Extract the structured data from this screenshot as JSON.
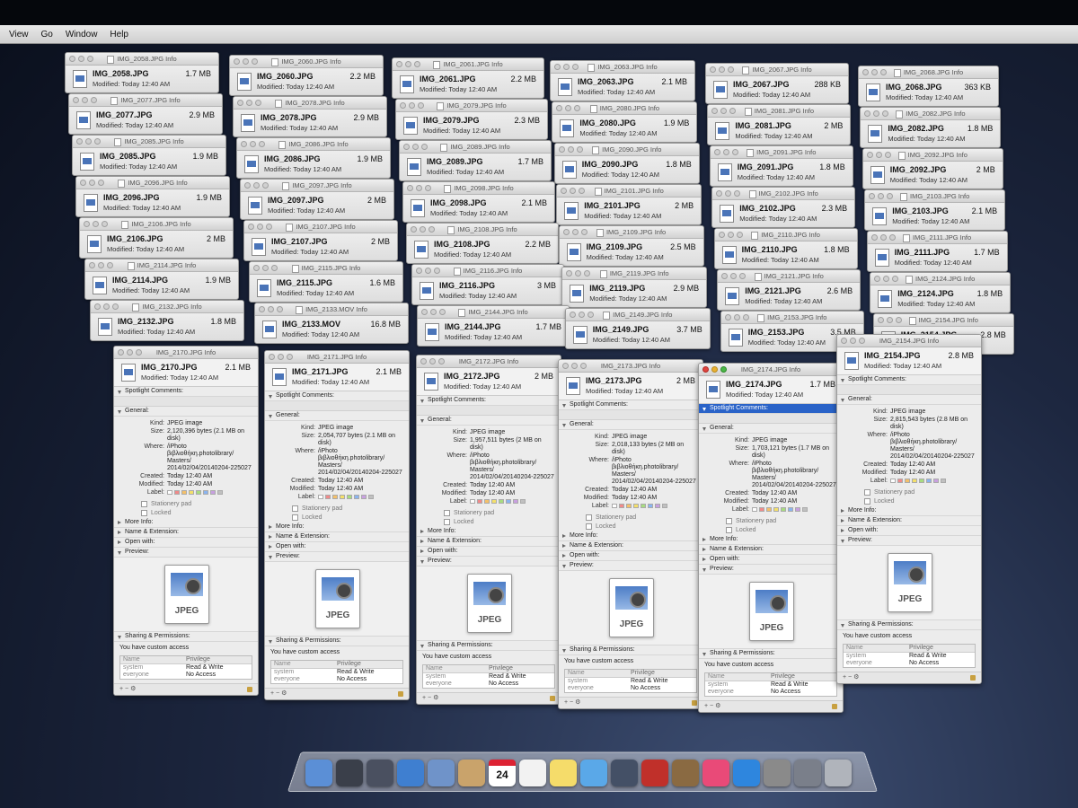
{
  "menubar": {
    "items": [
      "View",
      "Go",
      "Window",
      "Help"
    ]
  },
  "info_windows": [
    {
      "title": "IMG_2058.JPG Info",
      "name": "IMG_2058.JPG",
      "size": "1.7 MB",
      "modified": "Modified: Today 12:40 AM"
    },
    {
      "title": "IMG_2060.JPG Info",
      "name": "IMG_2060.JPG",
      "size": "2.2 MB",
      "modified": "Modified: Today 12:40 AM"
    },
    {
      "title": "IMG_2061.JPG Info",
      "name": "IMG_2061.JPG",
      "size": "2.2 MB",
      "modified": "Modified: Today 12:40 AM"
    },
    {
      "title": "IMG_2063.JPG Info",
      "name": "IMG_2063.JPG",
      "size": "2.1 MB",
      "modified": "Modified: Today 12:40 AM"
    },
    {
      "title": "IMG_2067.JPG Info",
      "name": "IMG_2067.JPG",
      "size": "288 KB",
      "modified": "Modified: Today 12:40 AM"
    },
    {
      "title": "IMG_2068.JPG Info",
      "name": "IMG_2068.JPG",
      "size": "363 KB",
      "modified": "Modified: Today 12:40 AM"
    },
    {
      "title": "IMG_2077.JPG Info",
      "name": "IMG_2077.JPG",
      "size": "2.9 MB",
      "modified": "Modified: Today 12:40 AM"
    },
    {
      "title": "IMG_2078.JPG Info",
      "name": "IMG_2078.JPG",
      "size": "2.9 MB",
      "modified": "Modified: Today 12:40 AM"
    },
    {
      "title": "IMG_2079.JPG Info",
      "name": "IMG_2079.JPG",
      "size": "2.3 MB",
      "modified": "Modified: Today 12:40 AM"
    },
    {
      "title": "IMG_2080.JPG Info",
      "name": "IMG_2080.JPG",
      "size": "1.9 MB",
      "modified": "Modified: Today 12:40 AM"
    },
    {
      "title": "IMG_2081.JPG Info",
      "name": "IMG_2081.JPG",
      "size": "2 MB",
      "modified": "Modified: Today 12:40 AM"
    },
    {
      "title": "IMG_2082.JPG Info",
      "name": "IMG_2082.JPG",
      "size": "1.8 MB",
      "modified": "Modified: Today 12:40 AM"
    },
    {
      "title": "IMG_2085.JPG Info",
      "name": "IMG_2085.JPG",
      "size": "1.9 MB",
      "modified": "Modified: Today 12:40 AM"
    },
    {
      "title": "IMG_2086.JPG Info",
      "name": "IMG_2086.JPG",
      "size": "1.9 MB",
      "modified": "Modified: Today 12:40 AM"
    },
    {
      "title": "IMG_2089.JPG Info",
      "name": "IMG_2089.JPG",
      "size": "1.7 MB",
      "modified": "Modified: Today 12:40 AM"
    },
    {
      "title": "IMG_2090.JPG Info",
      "name": "IMG_2090.JPG",
      "size": "1.8 MB",
      "modified": "Modified: Today 12:40 AM"
    },
    {
      "title": "IMG_2091.JPG Info",
      "name": "IMG_2091.JPG",
      "size": "1.8 MB",
      "modified": "Modified: Today 12:40 AM"
    },
    {
      "title": "IMG_2092.JPG Info",
      "name": "IMG_2092.JPG",
      "size": "2 MB",
      "modified": "Modified: Today 12:40 AM"
    },
    {
      "title": "IMG_2096.JPG Info",
      "name": "IMG_2096.JPG",
      "size": "1.9 MB",
      "modified": "Modified: Today 12:40 AM"
    },
    {
      "title": "IMG_2097.JPG Info",
      "name": "IMG_2097.JPG",
      "size": "2 MB",
      "modified": "Modified: Today 12:40 AM"
    },
    {
      "title": "IMG_2098.JPG Info",
      "name": "IMG_2098.JPG",
      "size": "2.1 MB",
      "modified": "Modified: Today 12:40 AM"
    },
    {
      "title": "IMG_2101.JPG Info",
      "name": "IMG_2101.JPG",
      "size": "2 MB",
      "modified": "Modified: Today 12:40 AM"
    },
    {
      "title": "IMG_2102.JPG Info",
      "name": "IMG_2102.JPG",
      "size": "2.3 MB",
      "modified": "Modified: Today 12:40 AM"
    },
    {
      "title": "IMG_2103.JPG Info",
      "name": "IMG_2103.JPG",
      "size": "2.1 MB",
      "modified": "Modified: Today 12:40 AM"
    },
    {
      "title": "IMG_2106.JPG Info",
      "name": "IMG_2106.JPG",
      "size": "2 MB",
      "modified": "Modified: Today 12:40 AM"
    },
    {
      "title": "IMG_2107.JPG Info",
      "name": "IMG_2107.JPG",
      "size": "2 MB",
      "modified": "Modified: Today 12:40 AM"
    },
    {
      "title": "IMG_2108.JPG Info",
      "name": "IMG_2108.JPG",
      "size": "2.2 MB",
      "modified": "Modified: Today 12:40 AM"
    },
    {
      "title": "IMG_2109.JPG Info",
      "name": "IMG_2109.JPG",
      "size": "2.5 MB",
      "modified": "Modified: Today 12:40 AM"
    },
    {
      "title": "IMG_2110.JPG Info",
      "name": "IMG_2110.JPG",
      "size": "1.8 MB",
      "modified": "Modified: Today 12:40 AM"
    },
    {
      "title": "IMG_2111.JPG Info",
      "name": "IMG_2111.JPG",
      "size": "1.7 MB",
      "modified": "Modified: Today 12:40 AM"
    },
    {
      "title": "IMG_2114.JPG Info",
      "name": "IMG_2114.JPG",
      "size": "1.9 MB",
      "modified": "Modified: Today 12:40 AM"
    },
    {
      "title": "IMG_2115.JPG Info",
      "name": "IMG_2115.JPG",
      "size": "1.6 MB",
      "modified": "Modified: Today 12:40 AM"
    },
    {
      "title": "IMG_2116.JPG Info",
      "name": "IMG_2116.JPG",
      "size": "3 MB",
      "modified": "Modified: Today 12:40 AM"
    },
    {
      "title": "IMG_2119.JPG Info",
      "name": "IMG_2119.JPG",
      "size": "2.9 MB",
      "modified": "Modified: Today 12:40 AM"
    },
    {
      "title": "IMG_2121.JPG Info",
      "name": "IMG_2121.JPG",
      "size": "2.6 MB",
      "modified": "Modified: Today 12:40 AM"
    },
    {
      "title": "IMG_2124.JPG Info",
      "name": "IMG_2124.JPG",
      "size": "1.8 MB",
      "modified": "Modified: Today 12:40 AM"
    },
    {
      "title": "IMG_2132.JPG Info",
      "name": "IMG_2132.JPG",
      "size": "1.8 MB",
      "modified": "Modified: Today 12:40 AM"
    },
    {
      "title": "IMG_2133.MOV Info",
      "name": "IMG_2133.MOV",
      "size": "16.8 MB",
      "modified": "Modified: Today 12:40 AM"
    },
    {
      "title": "IMG_2144.JPG Info",
      "name": "IMG_2144.JPG",
      "size": "1.7 MB",
      "modified": "Modified: Today 12:40 AM"
    },
    {
      "title": "IMG_2149.JPG Info",
      "name": "IMG_2149.JPG",
      "size": "3.7 MB",
      "modified": "Modified: Today 12:40 AM"
    },
    {
      "title": "IMG_2153.JPG Info",
      "name": "IMG_2153.JPG",
      "size": "3.5 MB",
      "modified": "Modified: Today 12:40 AM"
    },
    {
      "title": "IMG_2154.JPG Info",
      "name": "IMG_2154.JPG",
      "size": "2.8 MB",
      "modified": "Modified: Today 12:40 AM"
    }
  ],
  "expanded_panels": [
    {
      "title": "IMG_2170.JPG Info",
      "name": "IMG_2170.JPG",
      "size_short": "2.1 MB",
      "modified": "Modified: Today 12:40 AM",
      "kind": "JPEG image",
      "size": "2,120,396 bytes (2.1 MB on disk)",
      "where": "/iPhoto βιβλιοθήκη.photolibrary/ Masters/ 2014/02/04/20140204-225027",
      "created": "Today 12:40 AM",
      "modified_full": "Today 12:40 AM",
      "active": false
    },
    {
      "title": "IMG_2171.JPG Info",
      "name": "IMG_2171.JPG",
      "size_short": "2.1 MB",
      "modified": "Modified: Today 12:40 AM",
      "kind": "JPEG image",
      "size": "2,054,707 bytes (2.1 MB on disk)",
      "where": "/iPhoto βιβλιοθήκη.photolibrary/ Masters/ 2014/02/04/20140204-225027",
      "created": "Today 12:40 AM",
      "modified_full": "Today 12:40 AM",
      "active": false
    },
    {
      "title": "IMG_2172.JPG Info",
      "name": "IMG_2172.JPG",
      "size_short": "2 MB",
      "modified": "Modified: Today 12:40 AM",
      "kind": "JPEG image",
      "size": "1,957,511 bytes (2 MB on disk)",
      "where": "/iPhoto βιβλιοθήκη.photolibrary/ Masters/ 2014/02/04/20140204-225027",
      "created": "Today 12:40 AM",
      "modified_full": "Today 12:40 AM",
      "active": false
    },
    {
      "title": "IMG_2173.JPG Info",
      "name": "IMG_2173.JPG",
      "size_short": "2 MB",
      "modified": "Modified: Today 12:40 AM",
      "kind": "JPEG image",
      "size": "2,018,133 bytes (2 MB on disk)",
      "where": "/iPhoto βιβλιοθήκη.photolibrary/ Masters/ 2014/02/04/20140204-225027",
      "created": "Today 12:40 AM",
      "modified_full": "Today 12:40 AM",
      "active": false
    },
    {
      "title": "IMG_2174.JPG Info",
      "name": "IMG_2174.JPG",
      "size_short": "1.7 MB",
      "modified": "Modified: Today 12:40 AM",
      "kind": "JPEG image",
      "size": "1,703,121 bytes (1.7 MB on disk)",
      "where": "/iPhoto βιβλιοθήκη.photolibrary/ Masters/ 2014/02/04/20140204-225027",
      "created": "Today 12:40 AM",
      "modified_full": "Today 12:40 AM",
      "active": true
    },
    {
      "title": "IMG_2154.JPG Info",
      "name": "IMG_2154.JPG",
      "size_short": "2.8 MB",
      "modified": "Modified: Today 12:40 AM",
      "kind": "JPEG image",
      "size": "2,815,543 bytes (2.8 MB on disk)",
      "where": "/iPhoto βιβλιοθήκη.photolibrary/ Masters/ 2014/02/04/20140204-225027",
      "created": "Today 12:40 AM",
      "modified_full": "Today 12:40 AM",
      "active": false
    }
  ],
  "panel_labels": {
    "spotlight": "Spotlight Comments:",
    "general": "General:",
    "kind_k": "Kind:",
    "size_k": "Size:",
    "where_k": "Where:",
    "created_k": "Created:",
    "modified_k": "Modified:",
    "label_k": "Label:",
    "stationery": "Stationery pad",
    "locked": "Locked",
    "more_info": "More Info:",
    "name_ext": "Name & Extension:",
    "open_with": "Open with:",
    "preview": "Preview:",
    "preview_label": "JPEG",
    "sharing": "Sharing & Permissions:",
    "custom_access": "You have custom access",
    "col_name": "Name",
    "col_priv": "Privilege",
    "perm_rows": [
      {
        "name": "system",
        "priv": "Read & Write"
      },
      {
        "name": "everyone",
        "priv": "No Access"
      }
    ]
  },
  "label_colors": [
    "#ffffff",
    "#f08a8a",
    "#f4c06a",
    "#f4e06a",
    "#a8dc80",
    "#8ab4f0",
    "#c8a0e0",
    "#c0c0c0"
  ],
  "dock": {
    "calendar_day": "24",
    "icons": [
      "finder-icon",
      "launchpad-icon",
      "mission-control-icon",
      "safari-icon",
      "preview-icon",
      "contacts-icon",
      "calendar-icon",
      "reminders-icon",
      "notes-icon",
      "messages-icon",
      "facetime-icon",
      "photo-booth-icon",
      "iphoto-icon",
      "itunes-icon",
      "app-store-icon",
      "system-preferences-icon",
      "utilities-icon",
      "trash-icon"
    ],
    "icon_colors": [
      "#5b8fd6",
      "#3a3f4a",
      "#4a5060",
      "#3f7fd0",
      "#6f93c9",
      "#c9a36b",
      "#ffffff",
      "#f2f2f2",
      "#f5dc6a",
      "#5aa8e8",
      "#445066",
      "#c0302a",
      "#8a6a42",
      "#e94a78",
      "#2e86de",
      "#8a8a8a",
      "#7a7f8a",
      "#b0b4bb"
    ]
  }
}
